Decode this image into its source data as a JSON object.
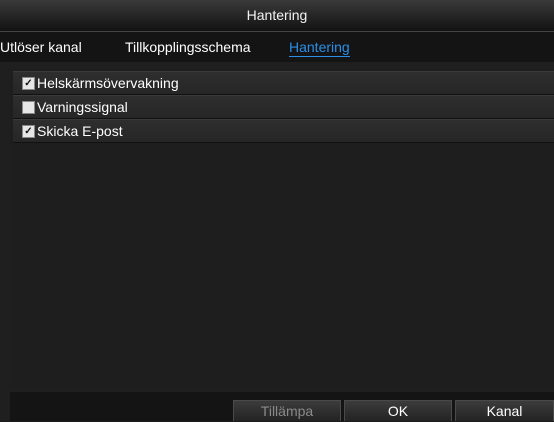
{
  "window": {
    "title": "Hantering"
  },
  "tabs": [
    {
      "label": "Utlöser kanal",
      "active": false
    },
    {
      "label": "Tillkopplingsschema",
      "active": false
    },
    {
      "label": "Hantering",
      "active": true
    }
  ],
  "options": [
    {
      "label": "Helskärmsövervakning",
      "checked": true
    },
    {
      "label": "Varningssignal",
      "checked": false
    },
    {
      "label": "Skicka E-post",
      "checked": true
    }
  ],
  "buttons": {
    "apply": "Tillämpa",
    "ok": "OK",
    "channel": "Kanal"
  },
  "colors": {
    "accent": "#2a8fe6",
    "background": "#1c1c1c"
  }
}
